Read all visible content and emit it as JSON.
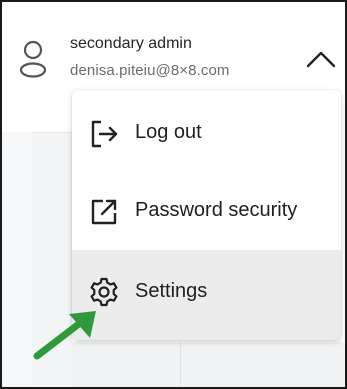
{
  "user": {
    "name": "secondary admin",
    "email": "denisa.piteiu@8×8.com"
  },
  "icons": {
    "avatar": "user-avatar-icon",
    "toggle": "chevron-up-icon",
    "logout": "log-out-icon",
    "password": "external-link-icon",
    "settings": "gear-icon",
    "annotation": "green-arrow-icon"
  },
  "menu": {
    "items": [
      {
        "label": "Log out"
      },
      {
        "label": "Password security"
      },
      {
        "label": "Settings"
      }
    ]
  },
  "colors": {
    "highlight": "#ececec",
    "annotation_arrow": "#2e9a3c"
  }
}
